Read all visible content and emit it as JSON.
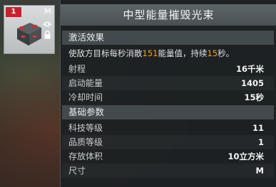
{
  "item": {
    "badge": "1",
    "size": "M"
  },
  "panel": {
    "title": "中型能量摧毁光束",
    "effect_section": "激活效果",
    "description": {
      "pre": "使敌方目标每秒消散",
      "value": "151",
      "mid": "能量值，持续",
      "duration": "15",
      "post": "秒。"
    },
    "effect_rows": [
      {
        "label": "射程",
        "value": "16千米"
      },
      {
        "label": "启动能量",
        "value": "1405"
      },
      {
        "label": "冷却时间",
        "value": "15秒"
      }
    ],
    "base_section": "基础参数",
    "base_rows": [
      {
        "label": "科技等级",
        "value": "11"
      },
      {
        "label": "品质等级",
        "value": "1"
      },
      {
        "label": "存放体积",
        "value": "10立方米"
      },
      {
        "label": "尺寸",
        "value": "M"
      }
    ]
  },
  "colors": {
    "highlight": "#f0a020",
    "badge": "#c7222c"
  }
}
